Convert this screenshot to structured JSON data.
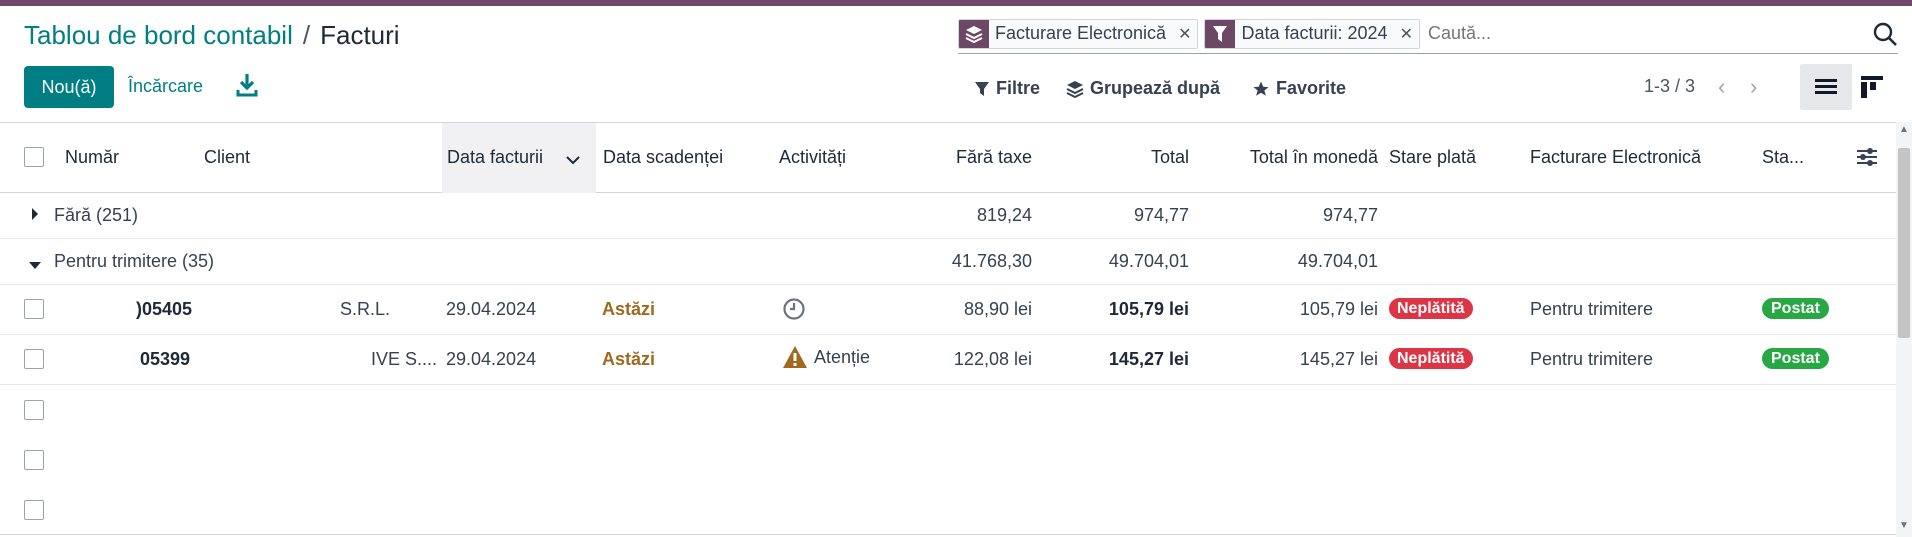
{
  "breadcrumb": {
    "parent": "Tablou de bord contabil",
    "separator": "/",
    "current": "Facturi"
  },
  "actions": {
    "new_label": "Nou(ă)",
    "upload_label": "Încărcare",
    "download_icon": "download-icon"
  },
  "search": {
    "facets": [
      {
        "icon": "layers-icon",
        "label": "Facturare Electronică"
      },
      {
        "icon": "filter-icon",
        "label": "Data facturii: 2024"
      }
    ],
    "placeholder": "Caută..."
  },
  "toolbar": {
    "filters_label": "Filtre",
    "groupby_label": "Grupează după",
    "favorites_label": "Favorite"
  },
  "pager": {
    "value": "1-3 / 3"
  },
  "columns": {
    "number": "Număr",
    "client": "Client",
    "invoice_date": "Data facturii",
    "due_date": "Data scadenței",
    "activities": "Activități",
    "untaxed": "Fără taxe",
    "total": "Total",
    "total_currency": "Total în monedă",
    "payment_state": "Stare plată",
    "edi": "Facturare Electronică",
    "status": "Sta..."
  },
  "groups": [
    {
      "label": "Fără (251)",
      "untaxed": "819,24",
      "total": "974,77",
      "total_currency": "974,77",
      "expanded": false
    },
    {
      "label": "Pentru trimitere (35)",
      "untaxed": "41.768,30",
      "total": "49.704,01",
      "total_currency": "49.704,01",
      "expanded": true
    }
  ],
  "rows": [
    {
      "number": ")05405",
      "client": "S.R.L.",
      "invoice_date": "29.04.2024",
      "due_date": "Astăzi",
      "activity": "",
      "activity_icon": "clock-icon",
      "untaxed": "88,90 lei",
      "total": "105,79 lei",
      "total_currency": "105,79 lei",
      "payment_state": "Neplătită",
      "edi": "Pentru trimitere",
      "status": "Postat"
    },
    {
      "number": "05399",
      "client": "IVE S....",
      "invoice_date": "29.04.2024",
      "due_date": "Astăzi",
      "activity": "Atenție",
      "activity_icon": "warning-icon",
      "untaxed": "122,08 lei",
      "total": "145,27 lei",
      "total_currency": "145,27 lei",
      "payment_state": "Neplătită",
      "edi": "Pentru trimitere",
      "status": "Postat"
    }
  ],
  "colors": {
    "brand": "#71476e",
    "primary": "#017e84",
    "danger": "#dc3545",
    "success": "#28a745",
    "warning": "#a0691f"
  }
}
